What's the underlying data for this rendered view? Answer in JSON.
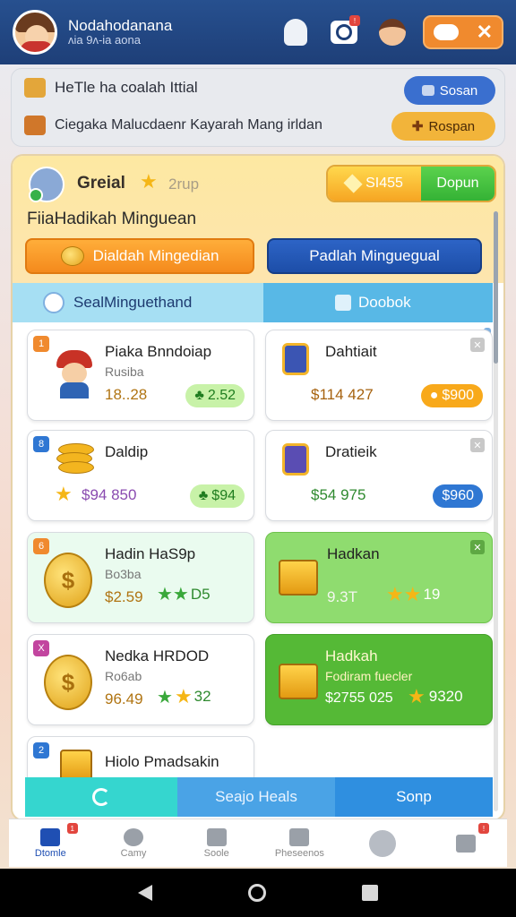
{
  "header": {
    "username": "Nodahodanana",
    "user_id": "ᴧia 9ᴧ-ia aona",
    "camera_badge": "!",
    "gift_badge": "!"
  },
  "banner": {
    "line1": "HeTle ha coalah Ittial",
    "line2": "Ciegaka Malucdaenr Kayarah Mang irldan",
    "btn1": "Sosan",
    "btn2": "Rospan"
  },
  "panel": {
    "guild_name": "Greial",
    "guild_sub": "2rup",
    "currency_value": "SI455",
    "currency_action": "Dopun",
    "title": "FiiaHadikah Minguean",
    "btn_orange": "Dialdah Mingedian",
    "btn_blue": "Padlah Minguegual",
    "tab1": "SealMinguethand",
    "tab2": "Doobok"
  },
  "cards": [
    {
      "tag": "1",
      "title": "Piaka Bnndoiap",
      "sub": "Rusiba",
      "value": "18..28",
      "pill": "2.52"
    },
    {
      "tag": "",
      "title": "Dahtiait",
      "value": "$114 427",
      "pill": "$900"
    },
    {
      "tag": "8",
      "title": "Daldip",
      "value": "$94 850",
      "pill": "$94"
    },
    {
      "tag": "",
      "title": "Dratieik",
      "value": "$54 975",
      "pill": "$960"
    },
    {
      "tag": "6",
      "title": "Hadin HaS9p",
      "sub": "Bo3ba",
      "value": "$2.59",
      "rating": "D5"
    },
    {
      "tag": "",
      "title": "Hadkan",
      "value": "9.3T",
      "rating": "19"
    },
    {
      "tag": "X",
      "title": "Nedka HRDOD",
      "sub": "Ro6ab",
      "value": "96.49",
      "rating": "32"
    },
    {
      "tag": "",
      "title": "Hadkah",
      "sub": "Fodiram fuecler",
      "value": "$2755 025",
      "rating": "9320"
    },
    {
      "tag": "2",
      "title": "Hiolo Pmadsakin"
    }
  ],
  "bottom_tabs": {
    "tab2": "Seajo Heals",
    "tab3": "Sonp"
  },
  "nav": {
    "home": "Dtomle",
    "camy": "Camy",
    "soole": "Soole",
    "pheseenos": "Pheseenos",
    "badge_home": "1",
    "badge_last": "!"
  }
}
